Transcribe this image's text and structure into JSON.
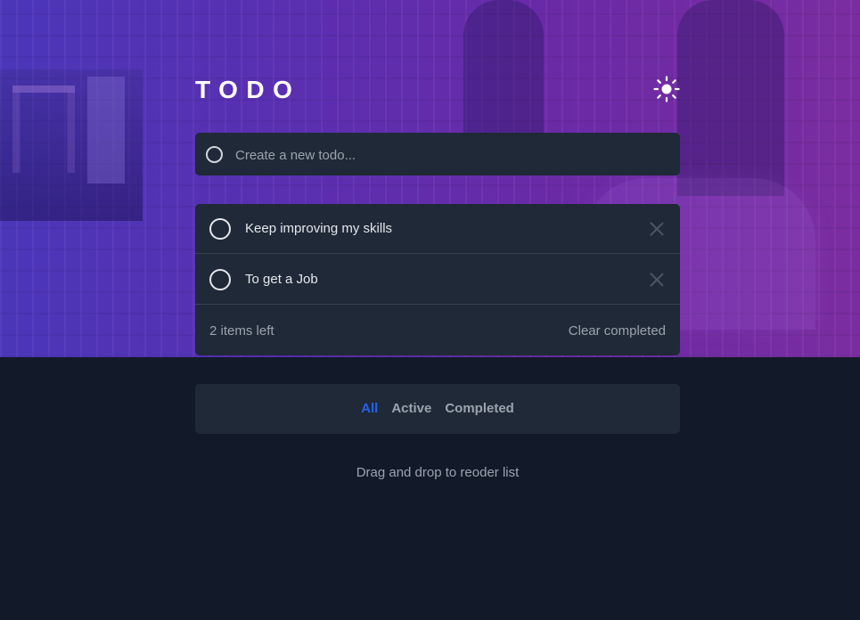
{
  "app": {
    "title": "TODO"
  },
  "header": {
    "theme_icon": "sun-icon"
  },
  "composer": {
    "placeholder": "Create a new todo..."
  },
  "todos": [
    {
      "text": "Keep improving my skills",
      "checked": false
    },
    {
      "text": "To get a Job",
      "checked": false
    }
  ],
  "list_footer": {
    "items_left": "2 items left",
    "clear_completed": "Clear completed"
  },
  "filters": {
    "all": "All",
    "active": "Active",
    "completed": "Completed"
  },
  "drag_note": "Drag and drop to reoder list",
  "colors": {
    "hero_start": "#4b36b8",
    "hero_end": "#7a2da0",
    "panel": "#1f2937",
    "page": "#121a29",
    "active_filter": "#2563eb"
  }
}
